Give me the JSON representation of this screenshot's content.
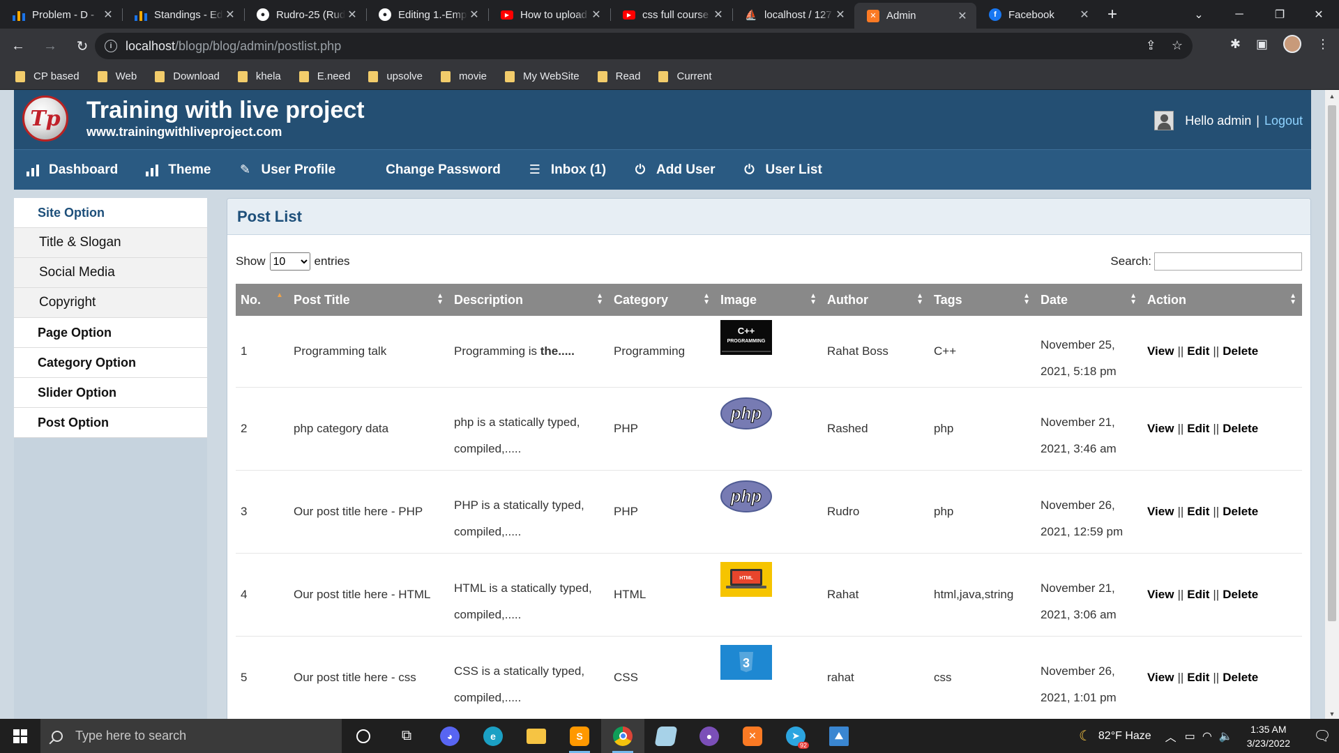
{
  "browser": {
    "tabs": [
      {
        "title": "Problem - D -",
        "icon": "bar-chart-icon",
        "color": "#1a73e8"
      },
      {
        "title": "Standings - Ed",
        "icon": "bar-chart-icon",
        "color": "#1a73e8"
      },
      {
        "title": "Rudro-25 (Rud",
        "icon": "github-icon",
        "color": "#ffffff"
      },
      {
        "title": "Editing 1.-Emp",
        "icon": "github-icon",
        "color": "#ffffff"
      },
      {
        "title": "How to upload",
        "icon": "youtube-icon",
        "color": "#ff0000"
      },
      {
        "title": "css full course",
        "icon": "youtube-icon",
        "color": "#ff0000"
      },
      {
        "title": "localhost / 127",
        "icon": "phpmyadmin-icon",
        "color": "#f29111"
      },
      {
        "title": "Admin",
        "icon": "xampp-icon",
        "color": "#fb7a24",
        "active": true
      },
      {
        "title": "Facebook",
        "icon": "facebook-icon",
        "color": "#1877f2"
      }
    ],
    "url_prefix": "localhost",
    "url_path": "/blogp/blog/admin/postlist.php",
    "bookmarks": [
      "CP based",
      "Web",
      "Download",
      "khela",
      "E.need",
      "upsolve",
      "movie",
      "My WebSite",
      "Read",
      "Current"
    ]
  },
  "site": {
    "logo_text": "Tp",
    "title": "Training with live project",
    "url": "www.trainingwithliveproject.com",
    "greeting": "Hello admin",
    "separator": "|",
    "logout": "Logout"
  },
  "nav": {
    "dashboard": "Dashboard",
    "theme": "Theme",
    "user_profile": "User Profile",
    "change_password": "Change Password",
    "inbox": "Inbox (1)",
    "add_user": "Add User",
    "user_list": "User List"
  },
  "sidebar": {
    "site_option": "Site Option",
    "title_slogan": "Title & Slogan",
    "social_media": "Social Media",
    "copyright": "Copyright",
    "page_option": "Page Option",
    "category_option": "Category Option",
    "slider_option": "Slider Option",
    "post_option": "Post Option"
  },
  "content": {
    "heading": "Post List",
    "show_label": "Show",
    "entries_value": "10",
    "entries_label": "entries",
    "search_label": "Search:",
    "columns": [
      "No.",
      "Post Title",
      "Description",
      "Category",
      "Image",
      "Author",
      "Tags",
      "Date",
      "Action"
    ],
    "rows": [
      {
        "no": "1",
        "title": "Programming talk",
        "desc_plain": "Programming is ",
        "desc_bold": "the.....",
        "category": "Programming",
        "image": "cpp-programming-thumbnail",
        "author": "Rahat Boss",
        "tags": "C++",
        "date1": "November 25,",
        "date2": "2021, 5:18 pm"
      },
      {
        "no": "2",
        "title": "php category data",
        "desc_plain": "php is a statically typed,",
        "desc_line2": "compiled,.....",
        "category": "PHP",
        "image": "php-logo-thumbnail",
        "author": "Rashed",
        "tags": "php",
        "date1": "November 21,",
        "date2": "2021, 3:46 am"
      },
      {
        "no": "3",
        "title": "Our post title here - PHP",
        "desc_plain": "PHP is a statically typed,",
        "desc_line2": "compiled,.....",
        "category": "PHP",
        "image": "php-logo-thumbnail",
        "author": "Rudro",
        "tags": "php",
        "date1": "November 26,",
        "date2": "2021, 12:59 pm"
      },
      {
        "no": "4",
        "title": "Our post title here - HTML",
        "desc_plain": "HTML is a statically typed,",
        "desc_line2": "compiled,.....",
        "category": "HTML",
        "image": "html-laptop-thumbnail",
        "author": "Rahat",
        "tags": "html,java,string",
        "date1": "November 21,",
        "date2": "2021, 3:06 am"
      },
      {
        "no": "5",
        "title": "Our post title here - css",
        "desc_plain": "CSS is a statically typed,",
        "desc_line2": "compiled,.....",
        "category": "CSS",
        "image": "css3-logo-thumbnail",
        "author": "rahat",
        "tags": "css",
        "date1": "November 26,",
        "date2": "2021, 1:01 pm"
      }
    ],
    "actions": {
      "view": "View",
      "edit": "Edit",
      "delete": "Delete",
      "sep": "||"
    }
  },
  "taskbar": {
    "search_placeholder": "Type here to search",
    "weather": "82°F  Haze",
    "time": "1:35 AM",
    "date": "3/23/2022",
    "telegram_badge": "92"
  },
  "colors": {
    "header_bg": "#244f73",
    "nav_bg": "#2a5a82",
    "page_bg": "#ced9e2",
    "table_head": "#898989",
    "accent_blue": "#1d4f7a"
  }
}
